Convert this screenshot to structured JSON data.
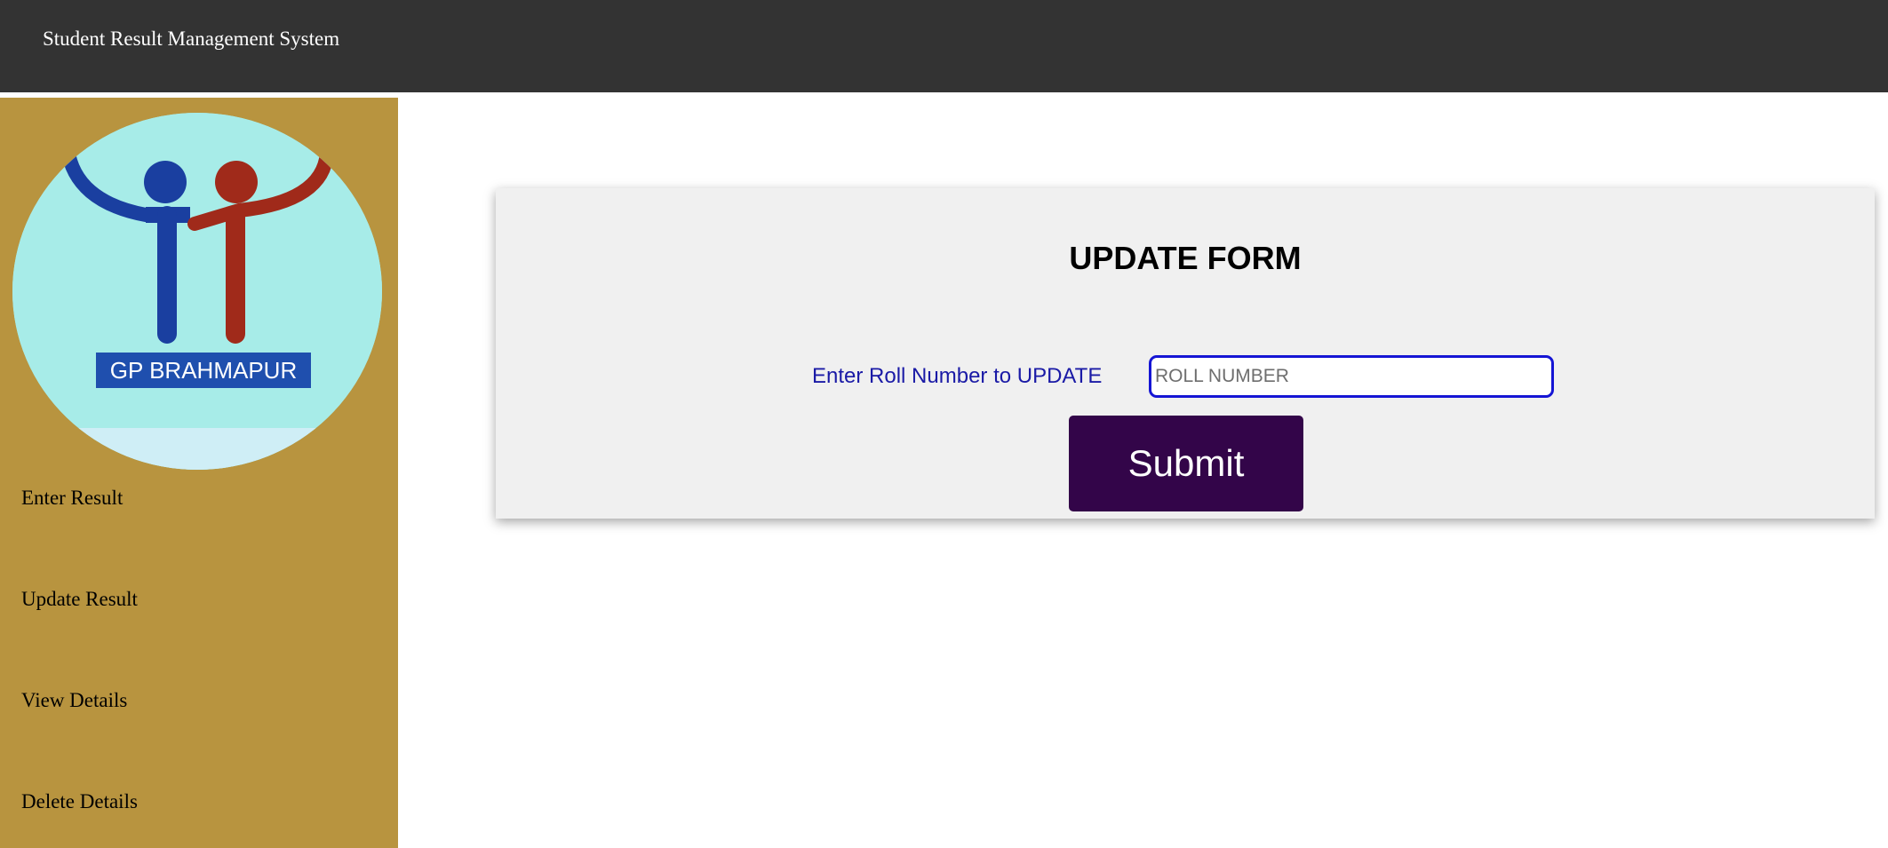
{
  "header": {
    "title": "Student Result Management System"
  },
  "sidebar": {
    "logo": {
      "icon": "gp-brahmapur-logo-icon",
      "text": "GP BRAHMAPUR"
    },
    "items": [
      {
        "label": "Enter Result"
      },
      {
        "label": "Update Result"
      },
      {
        "label": "View Details"
      },
      {
        "label": "Delete Details"
      }
    ]
  },
  "form": {
    "title": "UPDATE FORM",
    "roll_label": "Enter Roll Number to UPDATE",
    "roll_placeholder": "ROLL NUMBER",
    "roll_value": "",
    "submit_label": "Submit"
  },
  "colors": {
    "header_bg": "#333333",
    "sidebar_bg": "#b8943f",
    "panel_bg": "#f0f0f0",
    "label_color": "#1a1aa6",
    "input_border": "#1515d4",
    "button_bg": "#330549",
    "logo_blue": "#1a3fa0",
    "logo_red": "#a02a1a"
  }
}
